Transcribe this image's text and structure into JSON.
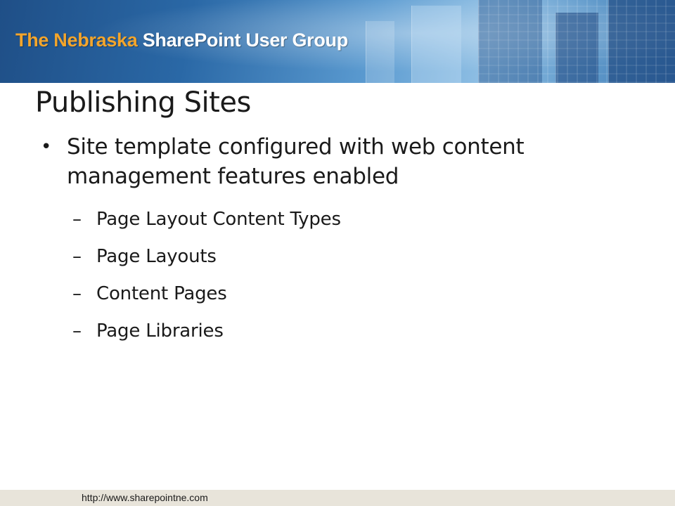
{
  "banner": {
    "title_accent": "The Nebraska",
    "title_main": "SharePoint User Group"
  },
  "slide": {
    "title": "Publishing Sites",
    "bullets": [
      {
        "text": "Site template configured with web content management features enabled",
        "subitems": [
          "Page Layout Content Types",
          "Page Layouts",
          "Content Pages",
          "Page Libraries"
        ]
      }
    ]
  },
  "footer": {
    "link": "http://www.sharepointne.com"
  },
  "colors": {
    "banner_blue": "#2a68a6",
    "accent_orange": "#f3a52c",
    "footer_bg": "#e8e4da"
  }
}
